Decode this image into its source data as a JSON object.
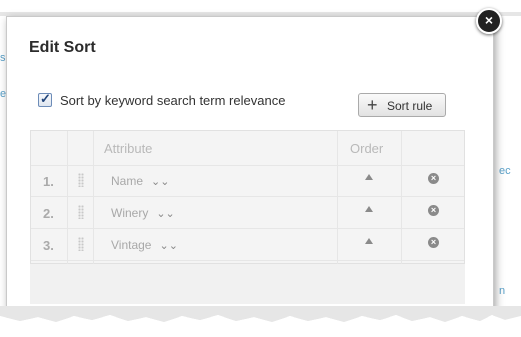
{
  "dialog": {
    "title": "Edit Sort",
    "close_icon": "close-icon",
    "keyword_checkbox": {
      "checked": true,
      "label": "Sort by keyword search term relevance"
    },
    "add_button": {
      "label": "Sort rule",
      "icon": "plus-icon"
    }
  },
  "grid": {
    "headers": {
      "attribute": "Attribute",
      "order": "Order"
    },
    "rows": [
      {
        "num": "1.",
        "attribute": "Name"
      },
      {
        "num": "2.",
        "attribute": "Winery"
      },
      {
        "num": "3.",
        "attribute": "Vintage"
      }
    ]
  },
  "background": {
    "frag_left1": "s",
    "frag_left2": "e",
    "frag_right1": "ec",
    "frag_right2": "n"
  },
  "colors": {
    "accent": "#22457a",
    "bg_link": "#5aa0c8"
  }
}
